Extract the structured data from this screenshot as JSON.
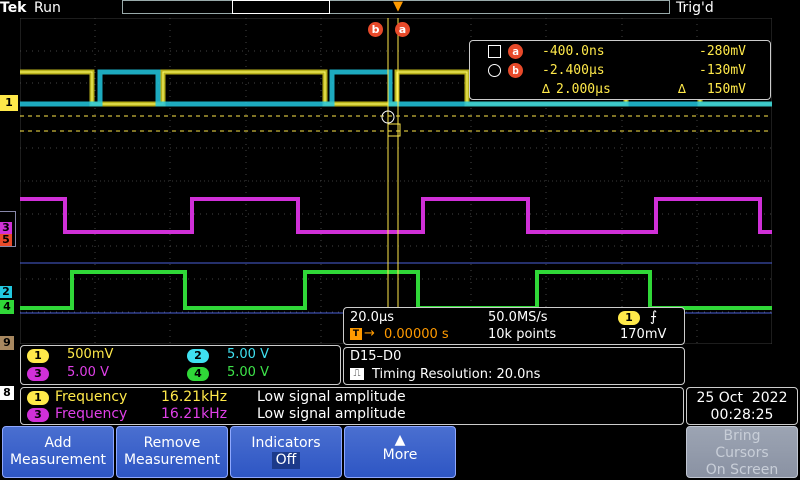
{
  "top": {
    "brand": "Tek",
    "run_state": "Run",
    "trigger_state": "Trig'd"
  },
  "cursors": {
    "a_label": "a",
    "b_label": "b",
    "a_time": "-400.0ns",
    "a_value": "-280mV",
    "b_time": "-2.400µs",
    "b_value": "-130mV",
    "delta_time": "2.000µs",
    "delta_value": "150mV",
    "delta_symbol": "∆"
  },
  "channel_markers": [
    "1",
    "3",
    "5",
    "2",
    "4",
    "9",
    "8"
  ],
  "timebase": {
    "scale": "20.0µs",
    "sample_rate": "50.0MS/s",
    "trigger_channel": "1",
    "trigger_slope_icon": "rising-edge",
    "delay": "0.00000 s",
    "record_length": "10k points",
    "trigger_level": "170mV"
  },
  "vertical": [
    {
      "ch": "1",
      "scale": "500mV",
      "color": "#ffe94a"
    },
    {
      "ch": "2",
      "scale": "5.00 V",
      "color": "#3fe0f0"
    },
    {
      "ch": "3",
      "scale": "5.00 V",
      "color": "#e040e8"
    },
    {
      "ch": "4",
      "scale": "5.00 V",
      "color": "#3ee44a"
    }
  ],
  "digital": {
    "group": "D15–D0",
    "timing": "Timing Resolution: 20.0ns"
  },
  "measurements": [
    {
      "ch": "1",
      "type": "Frequency",
      "value": "16.21kHz",
      "note": "Low signal amplitude",
      "color": "#ffe94a"
    },
    {
      "ch": "3",
      "type": "Frequency",
      "value": "16.21kHz",
      "note": "Low signal amplitude",
      "color": "#e040e8"
    }
  ],
  "datetime": {
    "date": "25 Oct  2022",
    "time": "00:28:25"
  },
  "softkeys": {
    "add_line1": "Add",
    "add_line2": "Measurement",
    "remove_line1": "Remove",
    "remove_line2": "Measurement",
    "indicators_line1": "Indicators",
    "indicators_line2": "Off",
    "more_label": "More",
    "bring_line1": "Bring",
    "bring_line2": "Cursors",
    "bring_line3": "On Screen"
  }
}
